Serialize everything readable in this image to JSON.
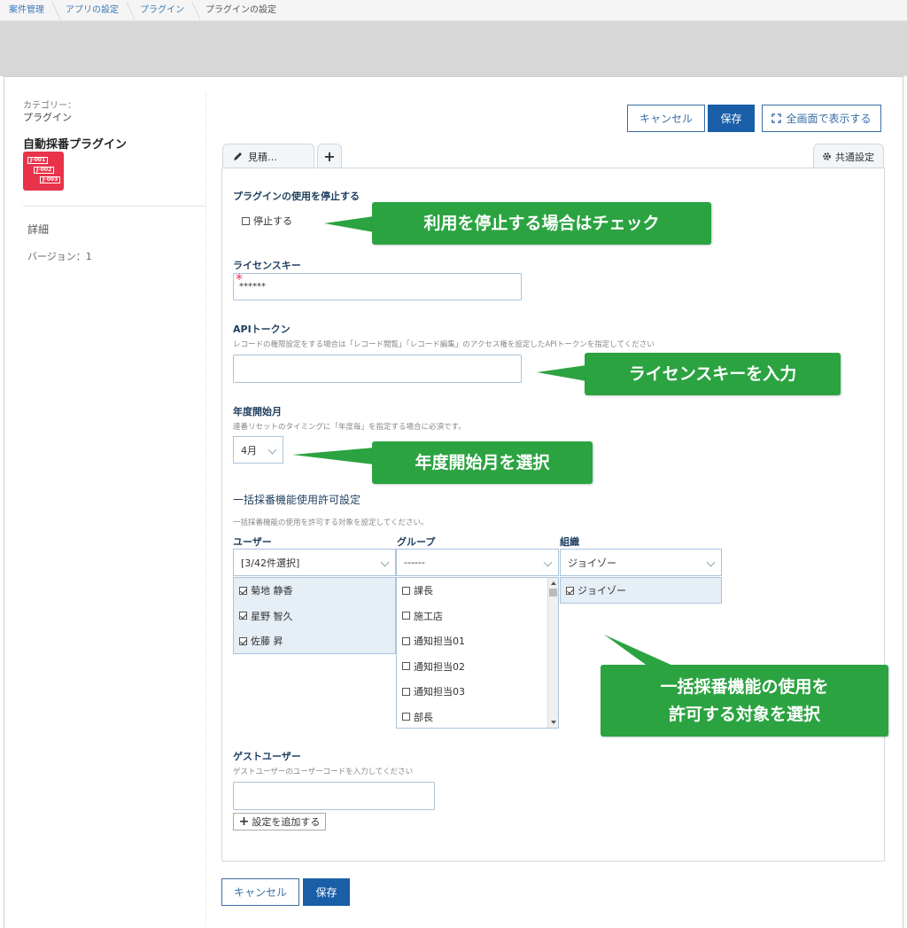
{
  "breadcrumb": [
    "案件管理",
    "アプリの設定",
    "プラグイン",
    "プラグインの設定"
  ],
  "sidebar": {
    "category_label": "カテゴリー：",
    "category_value": "プラグイン",
    "plugin_title": "自動採番プラグイン",
    "icon_labels": [
      "J-001",
      "J-002",
      "J-003"
    ],
    "detail": "詳細",
    "version": "バージョン：1"
  },
  "toolbar": {
    "cancel": "キャンセル",
    "save": "保存",
    "fullscreen": "全画面で表示する"
  },
  "tabs": {
    "first": "見積…",
    "add": "+",
    "common": "共通設定"
  },
  "form": {
    "stop_title": "プラグインの使用を停止する",
    "stop_checkbox": "停止する",
    "license_title": "ライセンスキー",
    "license_required": "*",
    "license_value": "******",
    "api_title": "APIトークン",
    "api_hint": "レコードの権限設定をする場合は「レコード閲覧」「レコード編集」のアクセス権を設定したAPIトークンを指定してください",
    "year_title": "年度開始月",
    "year_hint": "連番リセットのタイミングに「年度毎」を指定する場合に必須です。",
    "year_value": "4月",
    "bulk_title": "一括採番機能使用許可設定",
    "bulk_hint": "一括採番機能の使用を許可する対象を設定してください。",
    "user_label": "ユーザー",
    "user_value": "[3/42件選択]",
    "users": [
      "菊地 静香",
      "星野 智久",
      "佐藤 昇"
    ],
    "group_label": "グループ",
    "group_value": "------",
    "groups": [
      "課長",
      "施工店",
      "通知担当01",
      "通知担当02",
      "通知担当03",
      "部長"
    ],
    "org_label": "組織",
    "org_value": "ジョイゾー",
    "orgs": [
      "ジョイゾー"
    ],
    "guest_title": "ゲストユーザー",
    "guest_hint": "ゲストユーザーのユーザーコードを入力してください",
    "add_setting": "設定を追加する"
  },
  "footer": {
    "cancel": "キャンセル",
    "save": "保存"
  },
  "callouts": {
    "stop": "利用を停止する場合はチェック",
    "license": "ライセンスキーを入力",
    "year": "年度開始月を選択",
    "bulk_line1": "一括採番機能の使用を",
    "bulk_line2": "許可する対象を選択"
  },
  "colors": {
    "primary": "#1a5ea8",
    "callout": "#2ba341",
    "plugin_icon": "#e8334a"
  }
}
